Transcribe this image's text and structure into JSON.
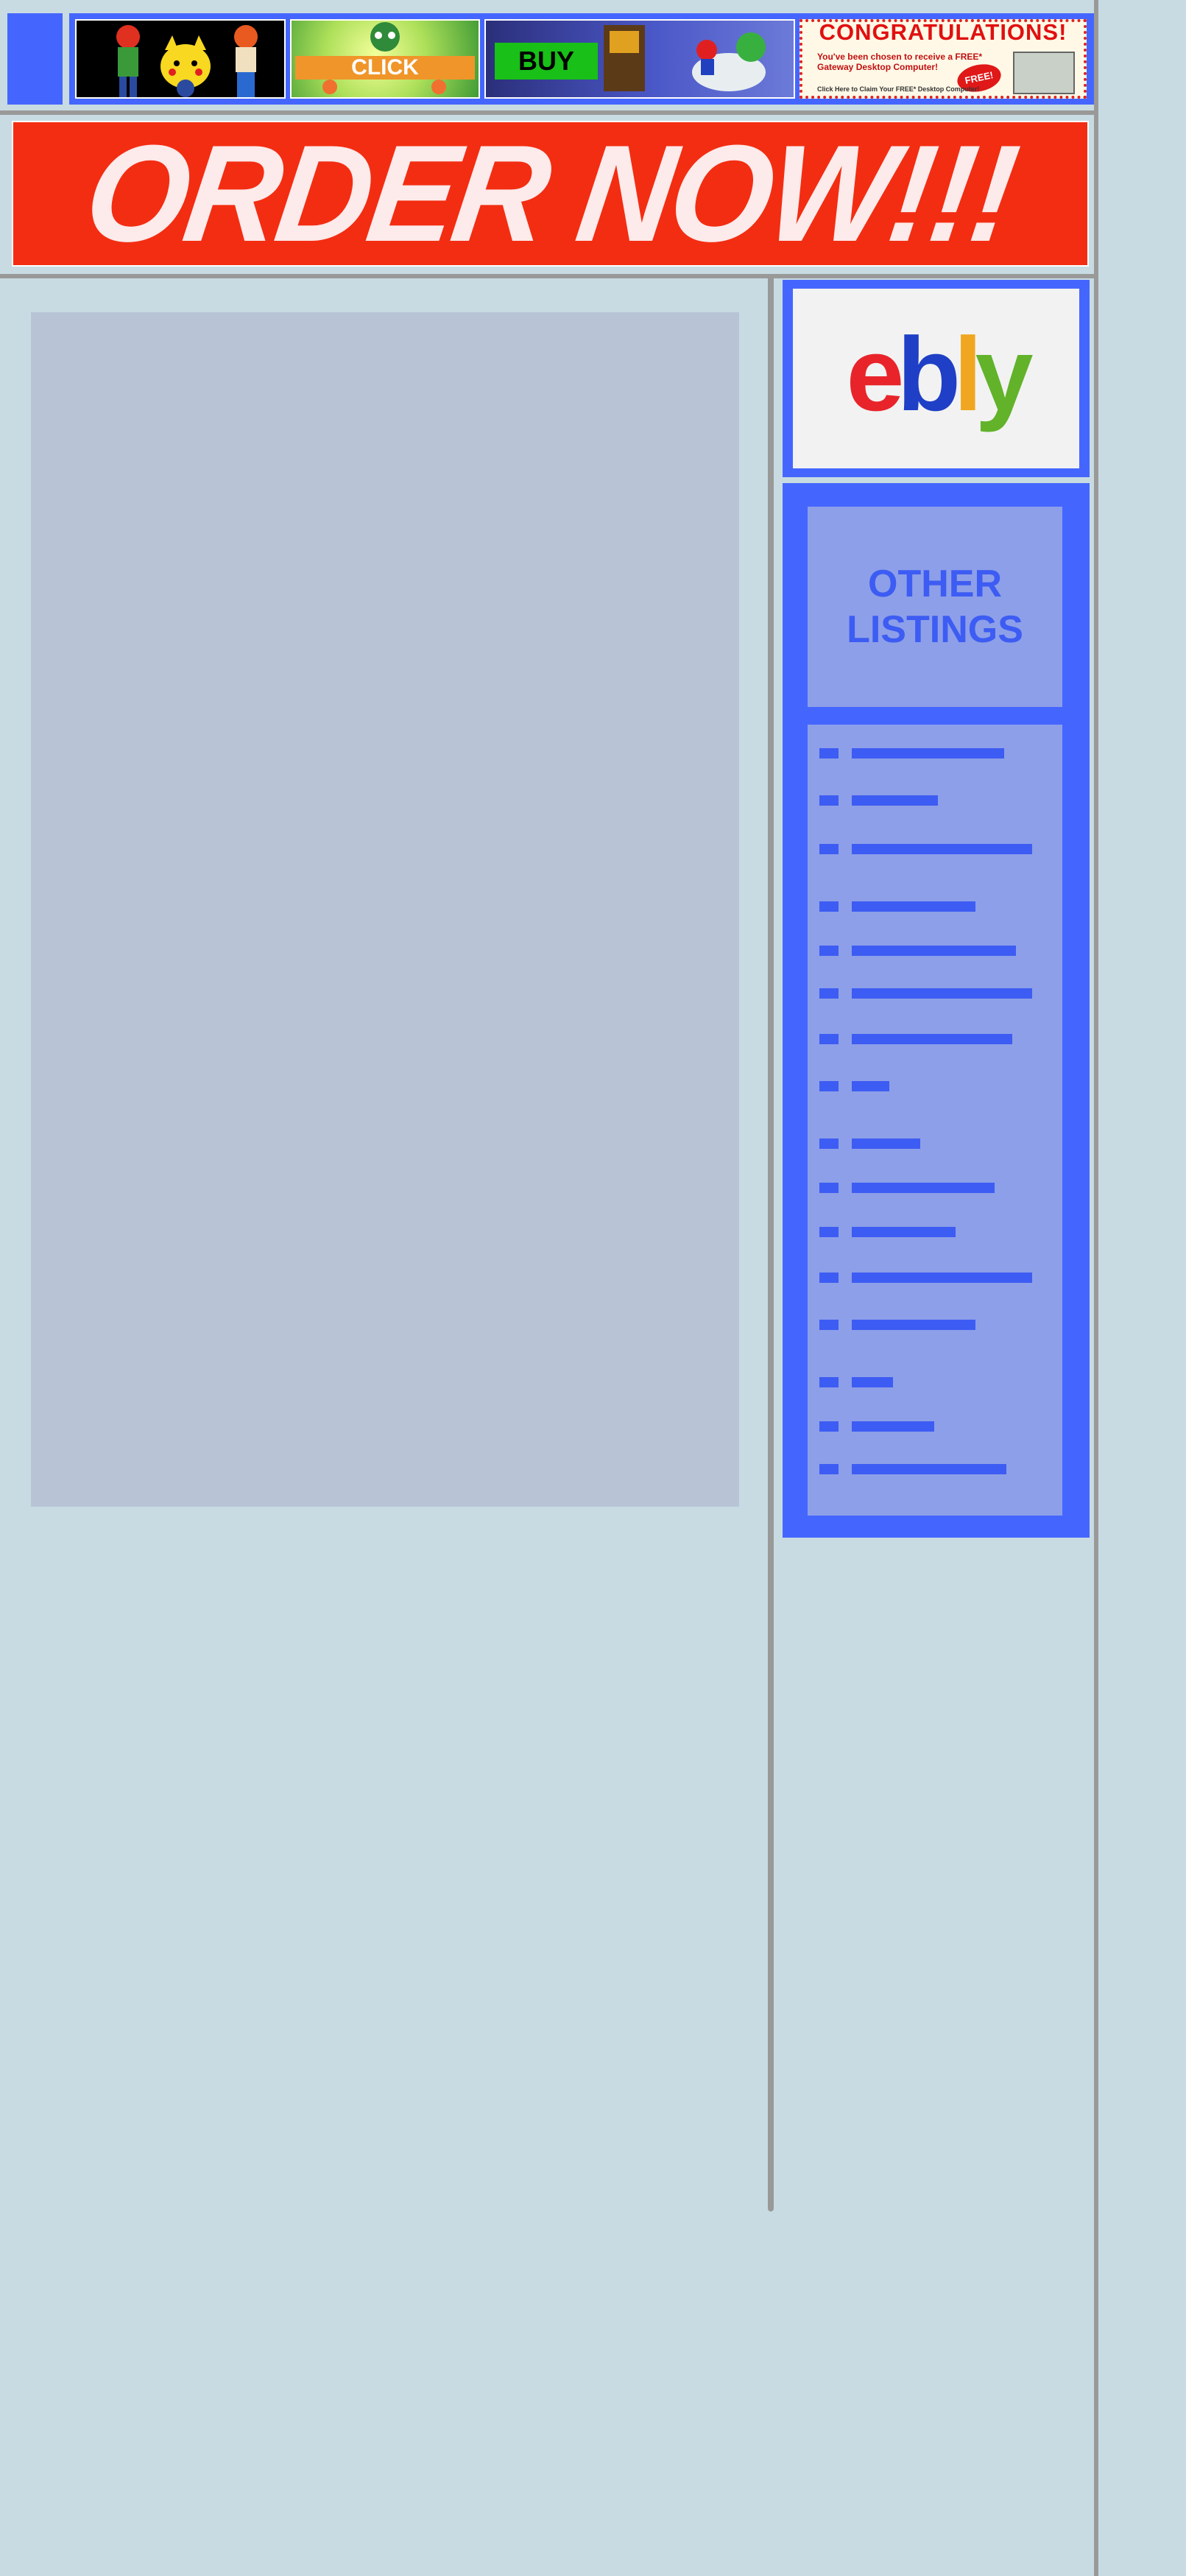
{
  "ads": [
    {
      "name": "pokemon-ad"
    },
    {
      "name": "click-ad",
      "label": "CLICK"
    },
    {
      "name": "buy-ad",
      "label": "BUY"
    },
    {
      "name": "congratulations-ad",
      "title": "CONGRATULATIONS!",
      "subtitle": "You've been chosen to receive a FREE* Gateway Desktop Computer!",
      "badge": "FREE!",
      "footer": "Click Here to Claim Your FREE* Desktop Computer!"
    }
  ],
  "banner": {
    "text": "ORDER NOW!!!",
    "color": "#f32d12"
  },
  "logo": {
    "e": "e",
    "b": "b",
    "l": "l",
    "y": "y"
  },
  "listings": {
    "title_line1": "OTHER",
    "title_line2": "LISTINGS",
    "items": [
      {
        "bar": 0.78
      },
      {
        "bar": 0.44
      },
      {
        "bar": 0.92
      },
      {
        "bar": 0.63
      },
      {
        "bar": 0.84
      },
      {
        "bar": 0.92
      },
      {
        "bar": 0.82
      },
      {
        "bar": 0.19
      },
      {
        "bar": 0.35
      },
      {
        "bar": 0.73
      },
      {
        "bar": 0.53
      },
      {
        "bar": 0.92
      },
      {
        "bar": 0.63
      },
      {
        "bar": 0.21
      },
      {
        "bar": 0.42
      },
      {
        "bar": 0.79
      }
    ]
  },
  "colors": {
    "accent": "#4466ff",
    "background": "#c8dbe2",
    "panel": "#b8c4d6",
    "divider": "#999999"
  }
}
